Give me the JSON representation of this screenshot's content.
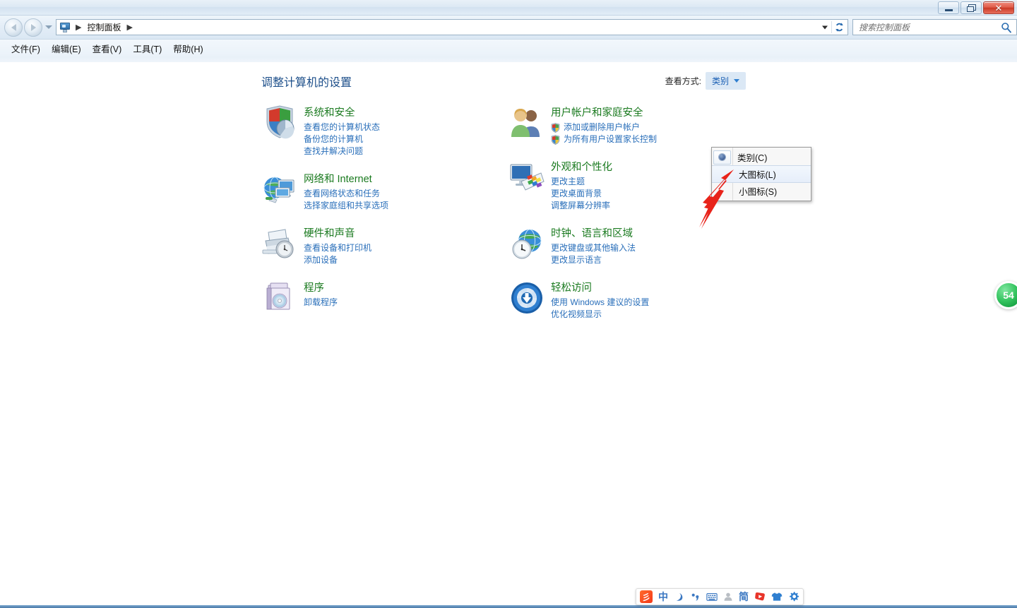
{
  "window": {
    "minimize_label": "最小化",
    "restore_label": "还原",
    "close_label": "关闭"
  },
  "address_bar": {
    "back_label": "后退",
    "forward_label": "前进",
    "history_label": "最近浏览的位置",
    "icon_name": "control-panel-icon",
    "crumbs": [
      "控制面板"
    ],
    "separator": "▶",
    "dropdown_label": "▼",
    "refresh_label": "刷新"
  },
  "search": {
    "placeholder": "搜索控制面板",
    "icon_name": "search-icon"
  },
  "menubar": {
    "items": [
      {
        "label": "文件(F)",
        "name": "menu-file"
      },
      {
        "label": "编辑(E)",
        "name": "menu-edit"
      },
      {
        "label": "查看(V)",
        "name": "menu-view"
      },
      {
        "label": "工具(T)",
        "name": "menu-tools"
      },
      {
        "label": "帮助(H)",
        "name": "menu-help"
      }
    ]
  },
  "main": {
    "page_title": "调整计算机的设置",
    "view_by_label": "查看方式:",
    "view_by_value": "类别"
  },
  "view_menu": {
    "items": [
      {
        "label": "类别(C)",
        "name": "view-option-category",
        "selected": true,
        "hover": false
      },
      {
        "label": "大图标(L)",
        "name": "view-option-large-icons",
        "selected": false,
        "hover": true
      },
      {
        "label": "小图标(S)",
        "name": "view-option-small-icons",
        "selected": false,
        "hover": false
      }
    ]
  },
  "categories": {
    "left": [
      {
        "name": "category-system-and-security",
        "icon": "shield-pie-icon",
        "title": "系统和安全",
        "links": [
          {
            "text": "查看您的计算机状态",
            "shield": false
          },
          {
            "text": "备份您的计算机",
            "shield": false
          },
          {
            "text": "查找并解决问题",
            "shield": false
          }
        ]
      },
      {
        "name": "category-network-and-internet",
        "icon": "globe-monitor-icon",
        "title": "网络和 Internet",
        "links": [
          {
            "text": "查看网络状态和任务",
            "shield": false
          },
          {
            "text": "选择家庭组和共享选项",
            "shield": false
          }
        ]
      },
      {
        "name": "category-hardware-and-sound",
        "icon": "printer-speaker-icon",
        "title": "硬件和声音",
        "links": [
          {
            "text": "查看设备和打印机",
            "shield": false
          },
          {
            "text": "添加设备",
            "shield": false
          }
        ]
      },
      {
        "name": "category-programs",
        "icon": "programs-box-icon",
        "title": "程序",
        "links": [
          {
            "text": "卸载程序",
            "shield": false
          }
        ]
      }
    ],
    "right": [
      {
        "name": "category-user-accounts-and-family-safety",
        "icon": "users-icon",
        "title": "用户帐户和家庭安全",
        "links": [
          {
            "text": "添加或删除用户帐户",
            "shield": true
          },
          {
            "text": "为所有用户设置家长控制",
            "shield": true
          }
        ]
      },
      {
        "name": "category-appearance-and-personalization",
        "icon": "monitor-palette-icon",
        "title": "外观和个性化",
        "links": [
          {
            "text": "更改主题",
            "shield": false
          },
          {
            "text": "更改桌面背景",
            "shield": false
          },
          {
            "text": "调整屏幕分辨率",
            "shield": false
          }
        ]
      },
      {
        "name": "category-clock-language-and-region",
        "icon": "globe-clock-icon",
        "title": "时钟、语言和区域",
        "links": [
          {
            "text": "更改键盘或其他输入法",
            "shield": false
          },
          {
            "text": "更改显示语言",
            "shield": false
          }
        ]
      },
      {
        "name": "category-ease-of-access",
        "icon": "ease-of-access-icon",
        "title": "轻松访问",
        "links": [
          {
            "text": "使用 Windows 建议的设置",
            "shield": false
          },
          {
            "text": "优化视频显示",
            "shield": false
          }
        ]
      }
    ]
  },
  "floating_badge": {
    "name": "green-count-badge",
    "text": "54"
  },
  "ime_toolbar": {
    "items": [
      {
        "name": "sogou-logo-icon",
        "kind": "logo",
        "text": "彡"
      },
      {
        "name": "chinese-mode-icon",
        "kind": "cn",
        "text": "中"
      },
      {
        "name": "moon-icon",
        "kind": "svg",
        "text": ""
      },
      {
        "name": "punctuation-icon",
        "kind": "svg",
        "text": ""
      },
      {
        "name": "soft-keyboard-icon",
        "kind": "svg",
        "text": ""
      },
      {
        "name": "user-icon",
        "kind": "svg",
        "text": ""
      },
      {
        "name": "simplified-mode-icon",
        "kind": "jian",
        "text": "简"
      },
      {
        "name": "video-icon",
        "kind": "svg",
        "text": ""
      },
      {
        "name": "skin-shirt-icon",
        "kind": "svg",
        "text": ""
      },
      {
        "name": "settings-gear-icon",
        "kind": "svg",
        "text": ""
      }
    ]
  },
  "colors": {
    "title_green": "#1a7a1f",
    "link_blue": "#2a6fba",
    "heading_blue": "#1d4f8a",
    "accent_blue": "#2f7fd0",
    "badge_green": "#34c45f",
    "annotation_red": "#e8231a",
    "ime_orange": "#f4391a"
  }
}
